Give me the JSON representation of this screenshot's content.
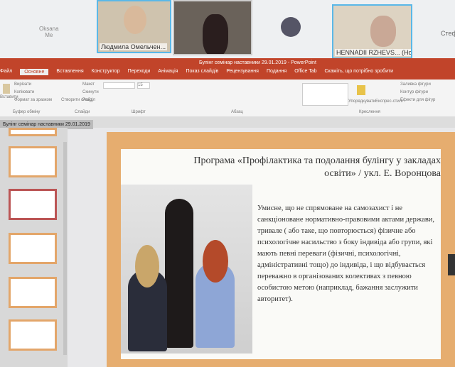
{
  "call": {
    "self": {
      "name": "Oksana",
      "label": "Me"
    },
    "participants": [
      {
        "name": "Людмила Омельчен..."
      },
      {
        "name": ""
      },
      {
        "name": ""
      },
      {
        "name": "HENNADII RZHEVS... (Host)"
      }
    ],
    "overflow_name": "Стефа"
  },
  "app": {
    "title": "Булінг семінар наставники 29.01.2019 - PowerPoint",
    "tabs": [
      "Файл",
      "Основне",
      "Вставлення",
      "Конструктор",
      "Переходи",
      "Анімація",
      "Показ слайдів",
      "Рецензування",
      "Подання",
      "Office Tab"
    ],
    "tell_me": "Скажіть, що потрібно зробити",
    "ribbon": {
      "paste": "Вставити",
      "cut": "Вирізати",
      "copy": "Копіювати",
      "format_painter": "Формат за зразком",
      "clipboard": "Буфер обміну",
      "new_slide": "Створити слайд",
      "layout": "Макет",
      "reset": "Скинути",
      "section": "Розділ",
      "slides": "Слайди",
      "font": "Шрифт",
      "font_size": "15",
      "paragraph": "Абзац",
      "arrange": "Упорядкувати",
      "quick_styles": "Експрес-стилі",
      "shape_fill": "Заливка фігури",
      "shape_outline": "Контур фігури",
      "shape_effects": "Ефекти для фігур",
      "drawing": "Креслення"
    },
    "doc_tab": "Булінг семінар наставники 29.01.2019"
  },
  "slide": {
    "title": "Програма «Профілактика та подолання булінгу у закладах освіти» / укл.  Е. Воронцова",
    "body": "Умисне, що не спрямоване на самозахист і не санкціоноване нормативно-правовими актами держави, тривале ( або таке, що повторюється) фізичне або психологічне насильство з боку індивіда або групи, які мають певні переваги (фізичні, психологічні, адміністративні тощо) до індивіда, і що відбувається переважно в організованих колективах з певною особистою метою (наприклад, бажання заслужити авторитет)."
  }
}
